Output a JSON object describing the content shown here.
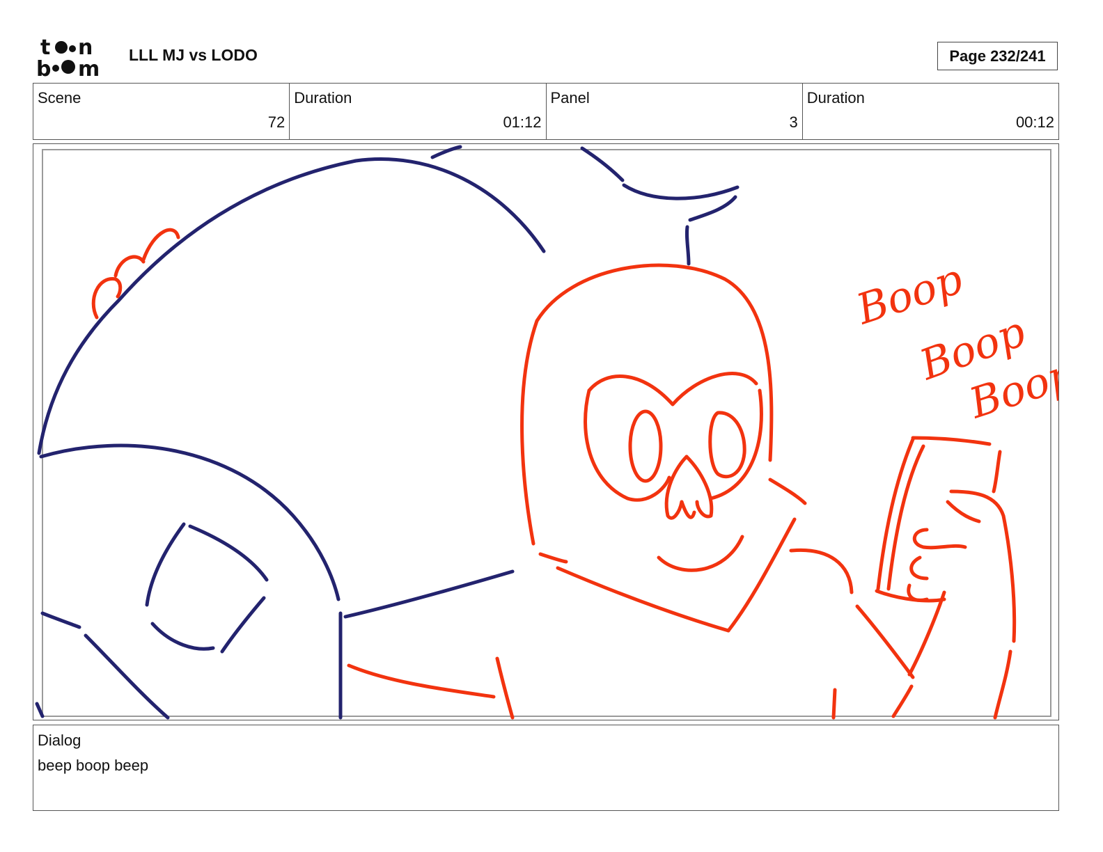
{
  "header": {
    "logo_text": "toon boom",
    "project_title": "LLL MJ vs LODO",
    "page_label": "Page 232/241"
  },
  "info": {
    "scene_label": "Scene",
    "scene_value": "72",
    "scene_duration_label": "Duration",
    "scene_duration_value": "01:12",
    "panel_label": "Panel",
    "panel_value": "3",
    "panel_duration_label": "Duration",
    "panel_duration_value": "00:12"
  },
  "panel": {
    "handwritten_sfx": [
      "Boop",
      "Boop",
      "Boop"
    ],
    "colors": {
      "navy_sketch": "#23236e",
      "red_sketch": "#f2330f",
      "safe_frame": "#9a9a9a"
    }
  },
  "dialog": {
    "label": "Dialog",
    "text": "beep boop beep"
  }
}
